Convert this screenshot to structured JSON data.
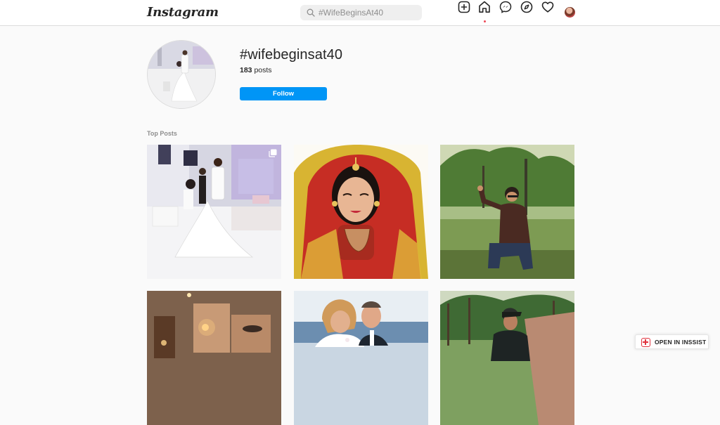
{
  "header": {
    "logo": "Instagram",
    "search_placeholder": "#WifeBeginsAt40",
    "nav_icons": [
      "new-post-icon",
      "home-icon",
      "messenger-icon",
      "explore-icon",
      "heart-icon",
      "profile-avatar"
    ]
  },
  "hashtag": {
    "title": "#wifebeginsat40",
    "post_count": "183",
    "post_count_suffix": " posts",
    "follow_label": "Follow"
  },
  "top_posts": {
    "heading": "Top Posts",
    "items": [
      {
        "subject": "wedding dance photo",
        "multi": true
      },
      {
        "subject": "bride in red and gold",
        "multi": false
      },
      {
        "subject": "man crouching in park",
        "multi": false
      },
      {
        "subject": "glowing candle portrait",
        "multi": false
      },
      {
        "subject": "wedding couple portrait",
        "multi": false
      },
      {
        "subject": "man in park with cap",
        "multi": false
      }
    ]
  },
  "inssist": {
    "label": "OPEN IN INSSIST"
  },
  "colors": {
    "accent": "#0095f6",
    "notification": "#ed4956",
    "inssist": "#e0323d"
  }
}
